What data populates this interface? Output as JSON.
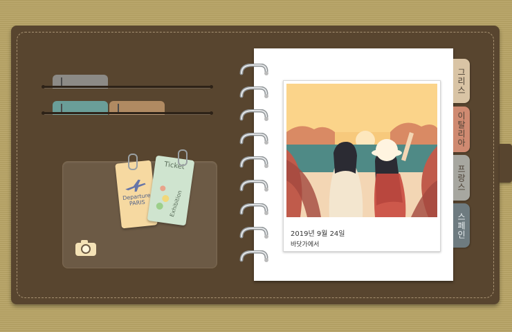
{
  "tabs": [
    {
      "label": "그리스",
      "color": "#d9c4a5"
    },
    {
      "label": "이탈리아",
      "color": "#cf8a71"
    },
    {
      "label": "프랑스",
      "color": "#a7a7a0"
    },
    {
      "label": "스페인",
      "color": "#6e7b80"
    }
  ],
  "photo": {
    "date": "2019년 9월 24일",
    "place": "바닷가에서"
  },
  "tickets": {
    "boarding": {
      "line1": "Departure",
      "line2": "PARIS",
      "icon": "airplane-icon"
    },
    "exhibition": {
      "title": "Ticket",
      "side": "Exhibition"
    }
  },
  "pocket_icon": "camera-icon",
  "colors": {
    "leather": "#58452f",
    "background": "#b9a567",
    "page": "#ffffff"
  }
}
